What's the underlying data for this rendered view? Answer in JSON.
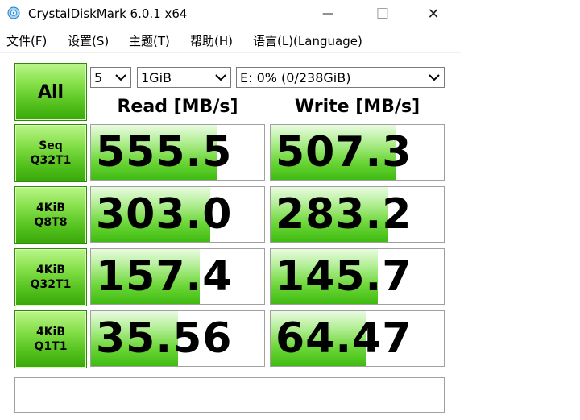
{
  "window": {
    "title": "CrystalDiskMark 6.0.1 x64",
    "minimize_glyph": "—",
    "maximize_glyph": "☐",
    "close_glyph": "✕"
  },
  "menu": {
    "items": [
      {
        "label": "文件(F)"
      },
      {
        "label": "设置(S)"
      },
      {
        "label": "主题(T)"
      },
      {
        "label": "帮助(H)"
      },
      {
        "label": "语言(L)(Language)"
      }
    ]
  },
  "controls": {
    "all_label": "All",
    "count_value": "5",
    "size_value": "1GiB",
    "drive_value": "E: 0% (0/238GiB)"
  },
  "headers": {
    "read": "Read [MB/s]",
    "write": "Write [MB/s]"
  },
  "tests": [
    {
      "line1": "Seq",
      "line2": "Q32T1",
      "read": "555.5",
      "write": "507.3",
      "read_fill": 0.73,
      "write_fill": 0.72
    },
    {
      "line1": "4KiB",
      "line2": "Q8T8",
      "read": "303.0",
      "write": "283.2",
      "read_fill": 0.69,
      "write_fill": 0.68
    },
    {
      "line1": "4KiB",
      "line2": "Q32T1",
      "read": "157.4",
      "write": "145.7",
      "read_fill": 0.63,
      "write_fill": 0.62
    },
    {
      "line1": "4KiB",
      "line2": "Q1T1",
      "read": "35.56",
      "write": "64.47",
      "read_fill": 0.5,
      "write_fill": 0.55
    }
  ],
  "comment": "",
  "colors": {
    "accent_green": "#4fbe1a",
    "bar_green": "#6fd83c"
  }
}
